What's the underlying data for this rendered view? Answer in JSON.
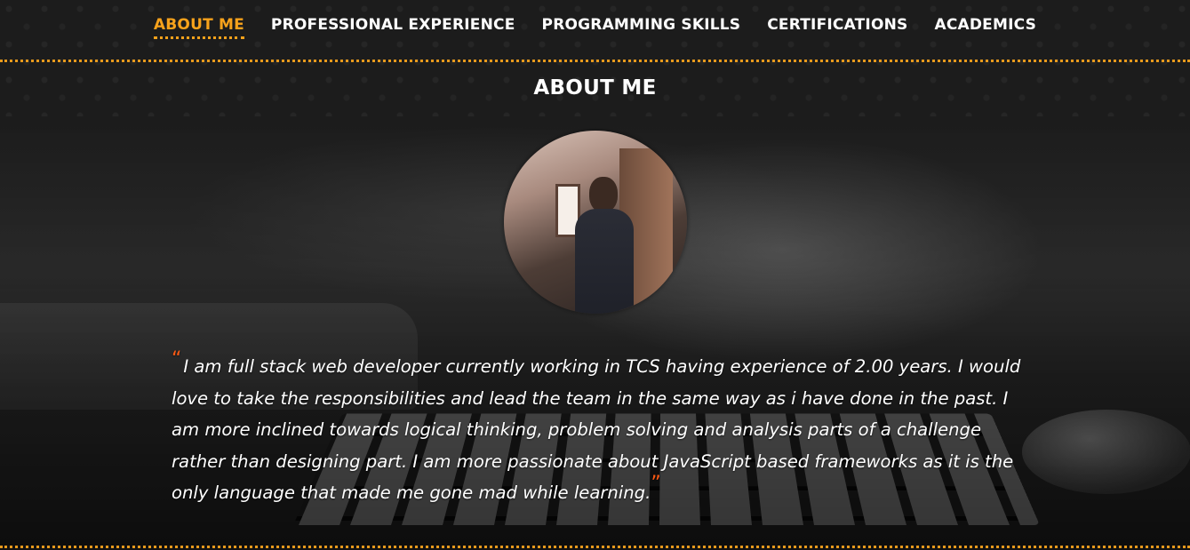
{
  "nav": {
    "items": [
      {
        "label": "ABOUT ME",
        "active": true
      },
      {
        "label": "PROFESSIONAL EXPERIENCE",
        "active": false
      },
      {
        "label": "PROGRAMMING SKILLS",
        "active": false
      },
      {
        "label": "CERTIFICATIONS",
        "active": false
      },
      {
        "label": "ACADEMICS",
        "active": false
      }
    ]
  },
  "section": {
    "title": "ABOUT ME"
  },
  "about": {
    "quote_open": "“",
    "quote_close": "”",
    "text": "I am full stack web developer currently working in TCS having experience of 2.00 years. I would love to take the responsibilities and lead the team in the same way as i have done in the past. I am more inclined towards logical thinking, problem solving and analysis parts of a challenge rather than designing part. I am more passionate about JavaScript based frameworks as it is the only language that made me gone mad while learning."
  },
  "icons": {
    "avatar": "profile-photo"
  },
  "colors": {
    "accent": "#f7a21b",
    "quote_mark": "#ff5a14",
    "dots": "#e89a1c",
    "text": "#ffffff"
  }
}
